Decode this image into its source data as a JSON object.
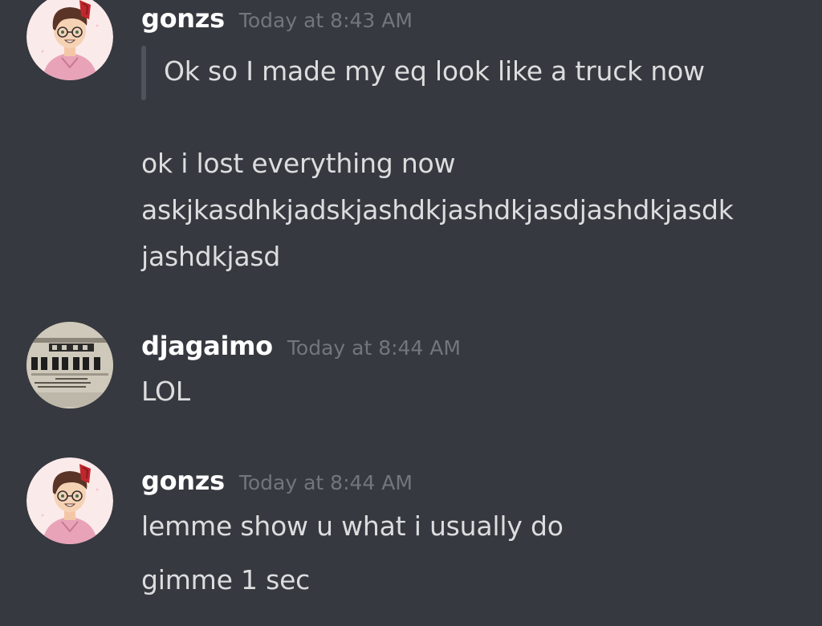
{
  "messages": [
    {
      "username": "gonzs",
      "timestamp": "Today at 8:43 AM",
      "avatar_icon": "cartoon-girl-avatar-icon",
      "quote": "Ok so I made my eq look like a truck now",
      "lines": [
        "ok i lost everything now",
        "askjkasdhkjadskjashdkjashdkjasdjashdkjasdk",
        "jashdkjasd"
      ]
    },
    {
      "username": "djagaimo",
      "timestamp": "Today at 8:44 AM",
      "avatar_icon": "newspaper-avatar-icon",
      "lines": [
        "LOL"
      ]
    },
    {
      "username": "gonzs",
      "timestamp": "Today at 8:44 AM",
      "avatar_icon": "cartoon-girl-avatar-icon",
      "lines": [
        "lemme show u what i usually do",
        "gimme 1 sec"
      ]
    }
  ],
  "colors": {
    "background": "#36393f",
    "username": "#ffffff",
    "timestamp": "#72767d",
    "text": "#dcddde",
    "quote_bar": "#4f545c"
  }
}
